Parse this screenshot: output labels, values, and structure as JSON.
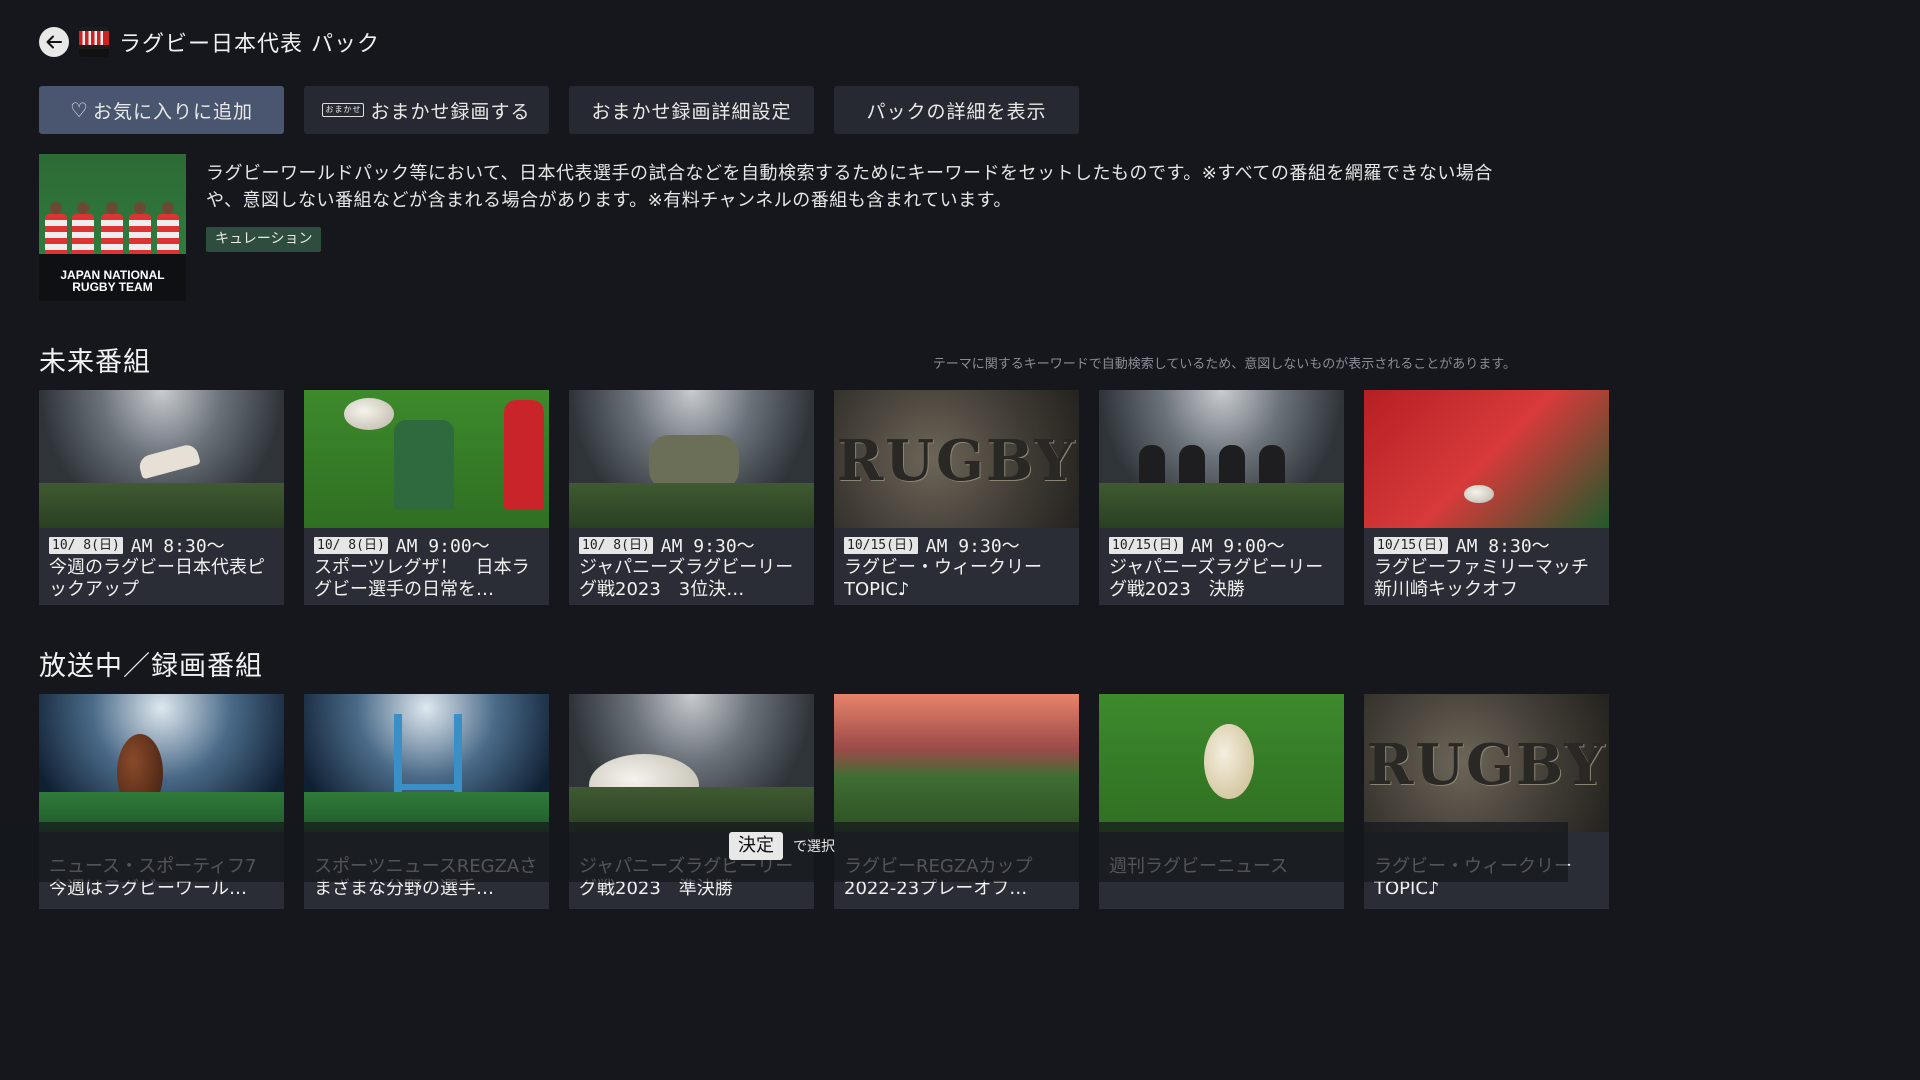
{
  "header": {
    "title": "ラグビー日本代表 パック",
    "back_icon": "arrow-left-icon"
  },
  "actions": [
    {
      "label": "お気に入りに追加",
      "icon": "heart-icon",
      "active": true
    },
    {
      "label": "おまかせ録画する",
      "icon_text": "おまかせ",
      "active": false
    },
    {
      "label": "おまかせ録画詳細設定",
      "active": false
    },
    {
      "label": "パックの詳細を表示",
      "active": false
    }
  ],
  "description": {
    "image_label": "JAPAN NATIONAL RUGBY TEAM",
    "text": "ラグビーワールドパック等において、日本代表選手の試合などを自動検索するためにキーワードをセットしたものです。※すべての番組を網羅できない場合や、意図しない番組などが含まれる場合があります。※有料チャンネルの番組も含まれています。",
    "tag": "キュレーション"
  },
  "future": {
    "title": "未来番組",
    "note": "テーマに関するキーワードで自動検索しているため、意図しないものが表示されることがあります。",
    "items": [
      {
        "date": "10/ 8(日)",
        "time": "AM 8:30〜",
        "title": "今週のラグビー日本代表ピックアップ"
      },
      {
        "date": "10/ 8(日)",
        "time": "AM 9:00〜",
        "title": "スポーツレグザ！　日本ラグビー選手の日常を…"
      },
      {
        "date": "10/ 8(日)",
        "time": "AM 9:30〜",
        "title": "ジャパニーズラグビーリーグ戦2023　3位決…"
      },
      {
        "date": "10/15(日)",
        "time": "AM 9:30〜",
        "title": "ラグビー・ウィークリーTOPIC♪"
      },
      {
        "date": "10/15(日)",
        "time": "AM 9:00〜",
        "title": "ジャパニーズラグビーリーグ戦2023　決勝"
      },
      {
        "date": "10/15(日)",
        "time": "AM 8:30〜",
        "title": "ラグビーファミリーマッチ　新川崎キックオフ"
      }
    ]
  },
  "broadcast": {
    "title": "放送中／録画番組",
    "items": [
      {
        "title": "ニュース・スポーティフ7今週はラグビーワール…"
      },
      {
        "title": "スポーツニュースREGZAさまざまな分野の選手…"
      },
      {
        "title": "ジャパニーズラグビーリーグ戦2023　準決勝"
      },
      {
        "title": "ラグビーREGZAカップ2022-23プレーオフ…"
      },
      {
        "title": "週刊ラグビーニュース"
      },
      {
        "title": "ラグビー・ウィークリーTOPIC♪"
      }
    ]
  },
  "thumb_texts": {
    "rugby_word": "RUGBY"
  },
  "hint": {
    "key": "決定",
    "text": "で選択"
  },
  "colors": {
    "background": "#15171c",
    "active_button": "#4a5670",
    "tag_bg": "#2e4d3e"
  }
}
